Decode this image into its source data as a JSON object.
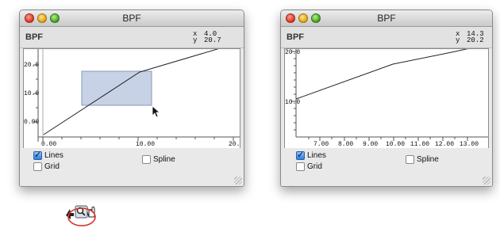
{
  "windows": [
    {
      "title": "BPF",
      "header_label": "BPF",
      "x_label": "x",
      "x_value": "4.0",
      "y_label": "y",
      "y_value": "20.7",
      "x_ticks": [
        "0.00",
        "10.00",
        "20.0"
      ],
      "y_ticks": [
        "20.0",
        "10.0",
        "0.00"
      ],
      "checkbox_lines": {
        "label": "Lines",
        "checked": true
      },
      "checkbox_grid": {
        "label": "Grid",
        "checked": false
      },
      "checkbox_spline": {
        "label": "Spline",
        "checked": false
      }
    },
    {
      "title": "BPF",
      "header_label": "BPF",
      "x_label": "x",
      "x_value": "14.3",
      "y_label": "y",
      "y_value": "20.2",
      "x_ticks": [
        "7.00",
        "8.00",
        "9.00",
        "10.00",
        "11.00",
        "12.00",
        "13.00"
      ],
      "y_ticks": [
        "20.0",
        "10.0"
      ],
      "checkbox_lines": {
        "label": "Lines",
        "checked": true
      },
      "checkbox_grid": {
        "label": "Grid",
        "checked": false
      },
      "checkbox_spline": {
        "label": "Spline",
        "checked": false
      }
    }
  ],
  "toolbar": {
    "icons": [
      "back-arrow-icon",
      "zoom-icon",
      "hand-icon"
    ],
    "highlight_color": "#d9322a"
  },
  "colors": {
    "selection_fill": "#c7d2e6",
    "selection_border": "#8a98b2",
    "curve": "#222222"
  }
}
